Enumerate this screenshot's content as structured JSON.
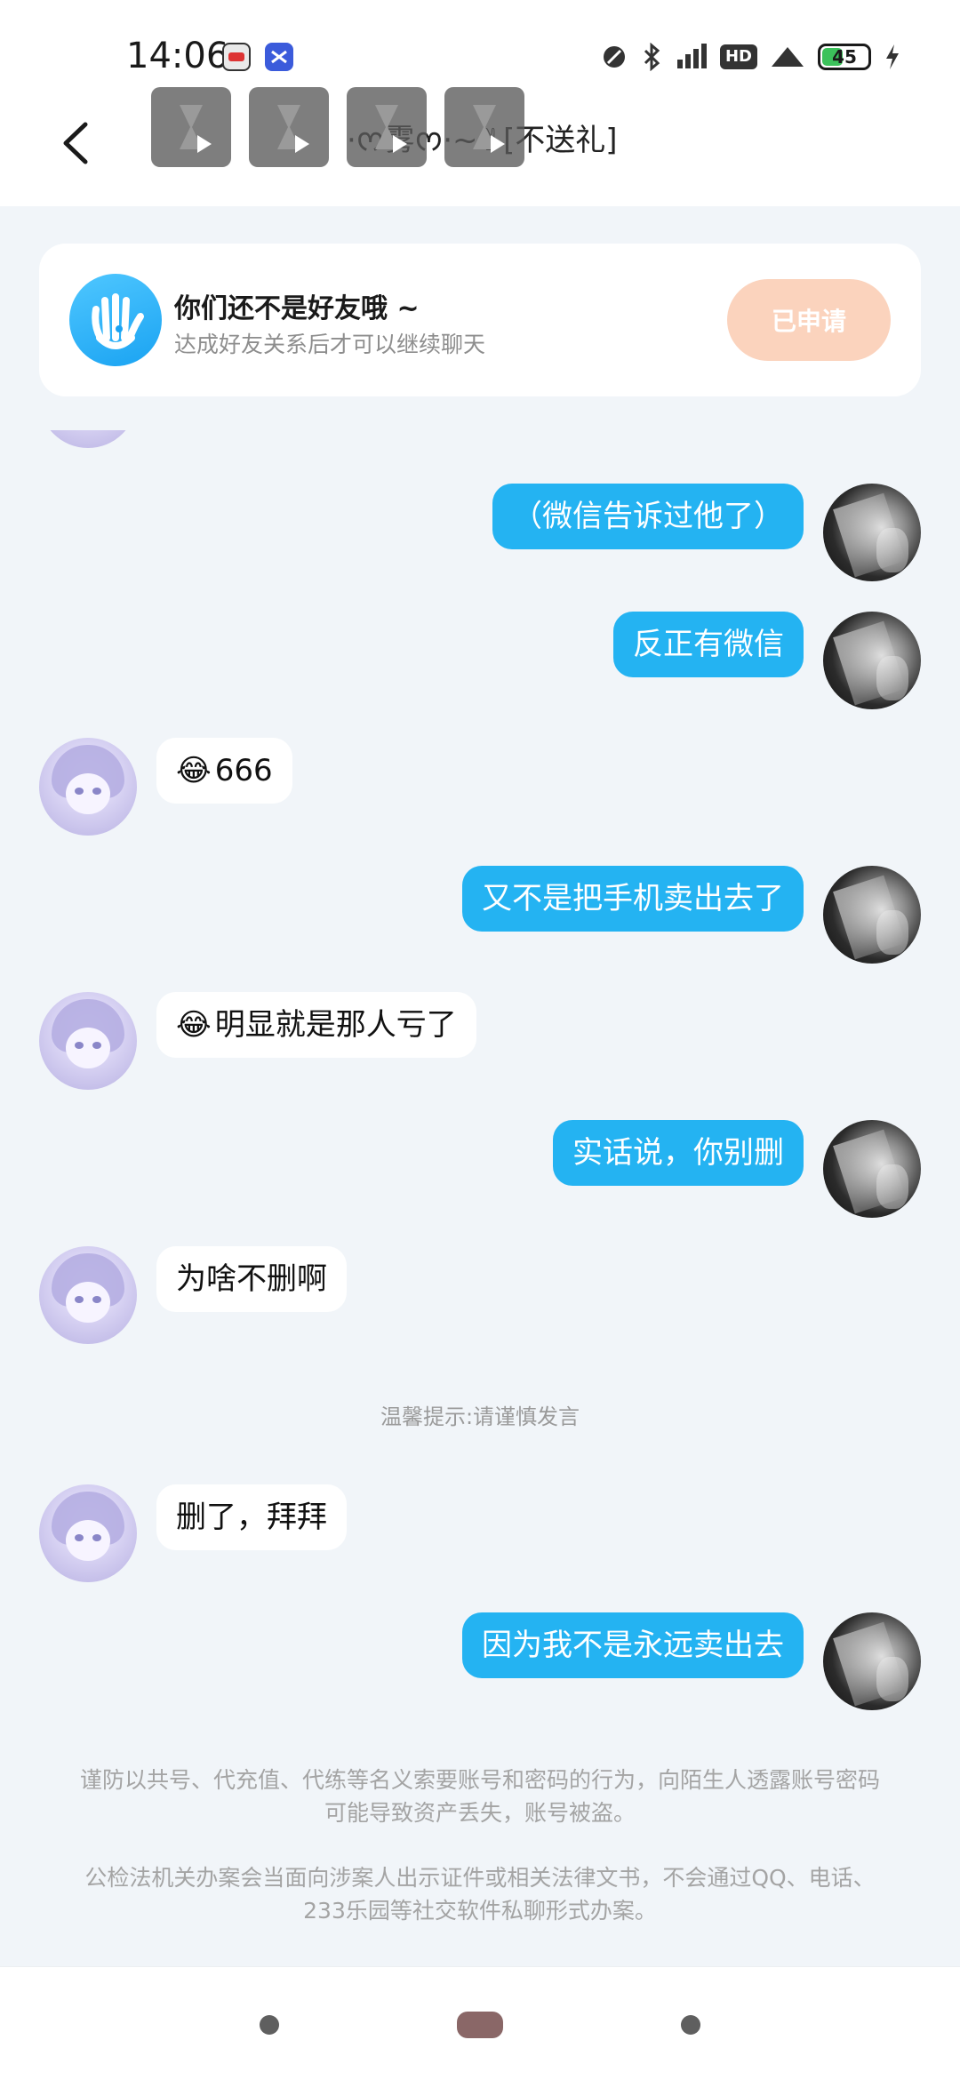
{
  "status_bar": {
    "time": "14:06",
    "icons": [
      "recorder-app-icon",
      "capcut-app-icon",
      "dnd-icon",
      "bluetooth-icon",
      "signal-icon",
      "hd-icon",
      "wifi-icon",
      "battery-icon",
      "charging-icon"
    ],
    "hd_label": "HD",
    "battery_level": "45"
  },
  "header": {
    "title": "·ᰔ雾ᰔ·~✌[不送礼]"
  },
  "friend_banner": {
    "title": "你们还不是好友哦 ~",
    "subtitle": "达成好友关系后才可以继续聊天",
    "button_label": "已申请"
  },
  "messages": [
    {
      "side": "me",
      "text": "（微信告诉过他了）",
      "emoji": ""
    },
    {
      "side": "me",
      "text": "反正有微信",
      "emoji": ""
    },
    {
      "side": "peer",
      "text": "666",
      "emoji": "😂"
    },
    {
      "side": "me",
      "text": "又不是把手机卖出去了",
      "emoji": ""
    },
    {
      "side": "peer",
      "text": "明显就是那人亏了",
      "emoji": "😂"
    },
    {
      "side": "me",
      "text": "实话说，你别删",
      "emoji": ""
    },
    {
      "side": "peer",
      "text": "为啥不删啊",
      "emoji": ""
    },
    {
      "side": "peer",
      "text": "删了，拜拜",
      "emoji": ""
    },
    {
      "side": "me",
      "text": "因为我不是永远卖出去",
      "emoji": ""
    }
  ],
  "system_tip": "温馨提示:请谨慎发言",
  "notices": [
    "谨防以共号、代充值、代练等名义索要账号和密码的行为，向陌生人透露账号密码可能导致资产丢失，账号被盗。",
    "公检法机关办案会当面向涉案人出示证件或相关法律文书，不会通过QQ、电话、233乐园等社交软件私聊形式办案。"
  ],
  "colors": {
    "my_bubble": "#24b3f2",
    "peer_bubble": "#ffffff",
    "applied_button": "#fbd3bd",
    "background": "#f1f5f9"
  }
}
